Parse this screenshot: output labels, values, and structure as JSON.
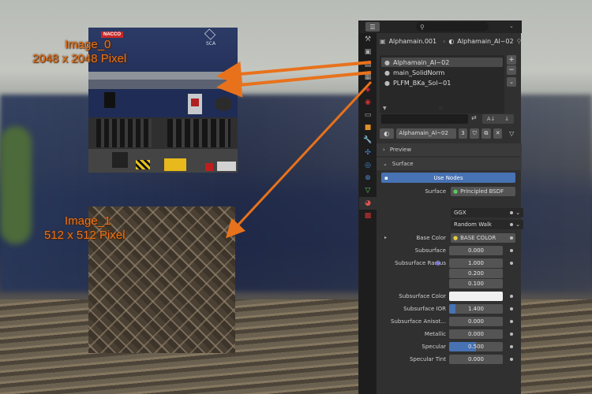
{
  "labels": {
    "image0_name": "Image_0",
    "image0_size": "2048 x 2048 Pixel",
    "image1_name": "Image_1",
    "image1_size": "512 x 512 Pixel"
  },
  "texture0": {
    "logo_left": "NACCO",
    "logo_right": "SCA"
  },
  "topbar": {
    "search_placeholder": ""
  },
  "header": {
    "object": "Alphamain.001",
    "material": "Alphamain_Al~02"
  },
  "material_slots": [
    "Alphamain_Al~02",
    "main_SolidNorm",
    "PLFM_BKa_Sol~01"
  ],
  "material_selector": {
    "name": "Alphamain_Al~02",
    "users": "3"
  },
  "sections": {
    "preview": "Preview",
    "surface": "Surface"
  },
  "use_nodes": "Use Nodes",
  "surface": {
    "label": "Surface",
    "value": "Principled BSDF"
  },
  "dropdowns": {
    "distribution": "GGX",
    "subsurface_method": "Random Walk"
  },
  "props": {
    "base_color_label": "Base Color",
    "base_color_value": "BASE COLOR",
    "subsurface_label": "Subsurface",
    "subsurface_value": "0.000",
    "subsurface_radius_label": "Subsurface Radius",
    "radius": [
      "1.000",
      "0.200",
      "0.100"
    ],
    "subsurface_color_label": "Subsurface Color",
    "subsurface_ior_label": "Subsurface IOR",
    "subsurface_ior_value": "1.400",
    "subsurface_aniso_label": "Subsurface Anisot...",
    "subsurface_aniso_value": "0.000",
    "metallic_label": "Metallic",
    "metallic_value": "0.000",
    "specular_label": "Specular",
    "specular_value": "0.500",
    "specular_tint_label": "Specular Tint",
    "specular_tint_value": "0.000"
  },
  "fills": {
    "subsurface_ior": 0.12,
    "specular": 0.5
  },
  "colors": {
    "accent": "#4772b3",
    "arrow": "#e8721c",
    "label": "#e8721c",
    "subsurface_color": "#f0f0f0"
  }
}
